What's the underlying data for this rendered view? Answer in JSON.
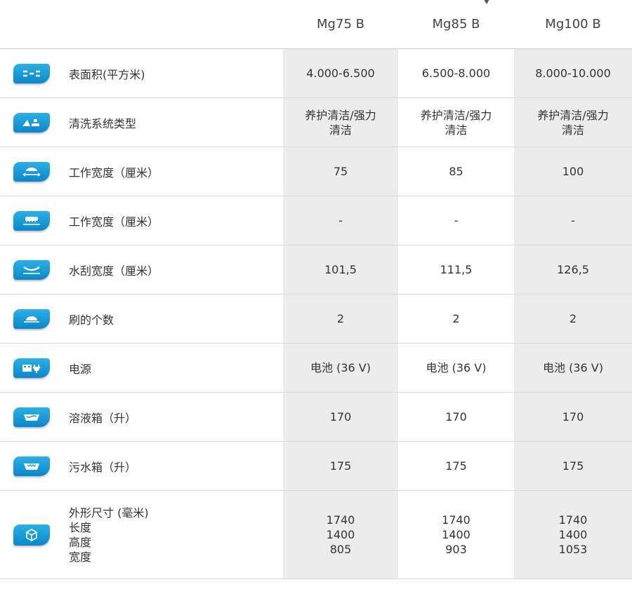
{
  "header": {
    "models": [
      "Mg75 B",
      "Mg85 B",
      "Mg100 B"
    ]
  },
  "rows": [
    {
      "icon": "surface-area-icon",
      "label": "表面积(平方米)",
      "values": [
        "4.000-6.500",
        "6.500-8.000",
        "8.000-10.000"
      ]
    },
    {
      "icon": "cleaning-system-icon",
      "label": "清洗系统类型",
      "values": [
        "养护清洁/强力\n清洁",
        "养护清洁/强力\n清洁",
        "养护清洁/强力\n清洁"
      ]
    },
    {
      "icon": "working-width-icon",
      "label": "工作宽度（厘米）",
      "values": [
        "75",
        "85",
        "100"
      ]
    },
    {
      "icon": "working-width-alt-icon",
      "label": "工作宽度（厘米）",
      "values": [
        "-",
        "-",
        "-"
      ]
    },
    {
      "icon": "squeegee-width-icon",
      "label": "水刮宽度（厘米）",
      "values": [
        "101,5",
        "111,5",
        "126,5"
      ]
    },
    {
      "icon": "brush-count-icon",
      "label": "刷的个数",
      "values": [
        "2",
        "2",
        "2"
      ]
    },
    {
      "icon": "power-source-icon",
      "label": "电源",
      "values": [
        "电池 (36 V)",
        "电池 (36 V)",
        "电池 (36 V)"
      ]
    },
    {
      "icon": "solution-tank-icon",
      "label": "溶液箱（升）",
      "values": [
        "170",
        "170",
        "170"
      ]
    },
    {
      "icon": "recovery-tank-icon",
      "label": "污水箱（升）",
      "values": [
        "175",
        "175",
        "175"
      ]
    }
  ],
  "dimensions": {
    "icon": "dimensions-cube-icon",
    "label_lines": [
      "外形尺寸 (毫米)",
      "长度",
      "高度",
      "宽度"
    ],
    "values": [
      [
        "1740",
        "1400",
        "805"
      ],
      [
        "1740",
        "1400",
        "903"
      ],
      [
        "1740",
        "1400",
        "1053"
      ]
    ]
  },
  "colors": {
    "icon_blue": "#1a9ad6",
    "shade": "#ececec"
  }
}
